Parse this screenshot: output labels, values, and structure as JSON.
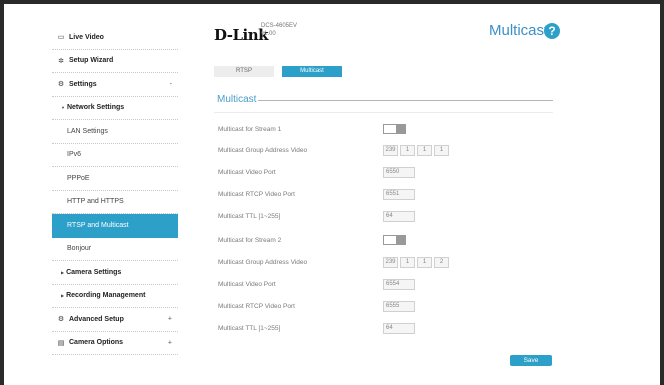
{
  "header": {
    "logo": "D-Link",
    "model_name": "DCS-4605EV",
    "model_version": "v1.00",
    "page_title": "Multicast",
    "help_label": "?"
  },
  "sidebar": {
    "live_video": "Live Video",
    "setup_wizard": "Setup Wizard",
    "settings": "Settings",
    "settings_mark": "-",
    "network_settings": "Network Settings",
    "lan_settings": "LAN Settings",
    "ipv6": "IPv6",
    "pppoe": "PPPoE",
    "http_https": "HTTP and HTTPS",
    "rtsp_multicast": "RTSP and Multicast",
    "bonjour": "Bonjour",
    "camera_settings": "Camera Settings",
    "recording_management": "Recording Management",
    "advanced_setup": "Advanced Setup",
    "advanced_mark": "+",
    "camera_options": "Camera Options",
    "camera_options_mark": "+"
  },
  "tabs": {
    "rtsp": "RTSP",
    "multicast": "Multicast"
  },
  "section_title": "Multicast",
  "stream1": {
    "toggle_label": "Multicast for Stream 1",
    "group_label": "Multicast Group Address Video",
    "group_octets": [
      "239",
      "1",
      "1",
      "1"
    ],
    "video_port_label": "Multicast Video Port",
    "video_port": "6550",
    "rtcp_port_label": "Multicast RTCP Video Port",
    "rtcp_port": "6551",
    "ttl_label": "Multicast TTL [1~255]",
    "ttl": "64"
  },
  "stream2": {
    "toggle_label": "Multicast for Stream 2",
    "group_label": "Multicast Group Address Video",
    "group_octets": [
      "239",
      "1",
      "1",
      "2"
    ],
    "video_port_label": "Multicast Video Port",
    "video_port": "6554",
    "rtcp_port_label": "Multicast RTCP Video Port",
    "rtcp_port": "6555",
    "ttl_label": "Multicast TTL [1~255]",
    "ttl": "64"
  },
  "save_label": "Save",
  "colors": {
    "accent": "#2da0c9",
    "title": "#3a8fc8"
  }
}
